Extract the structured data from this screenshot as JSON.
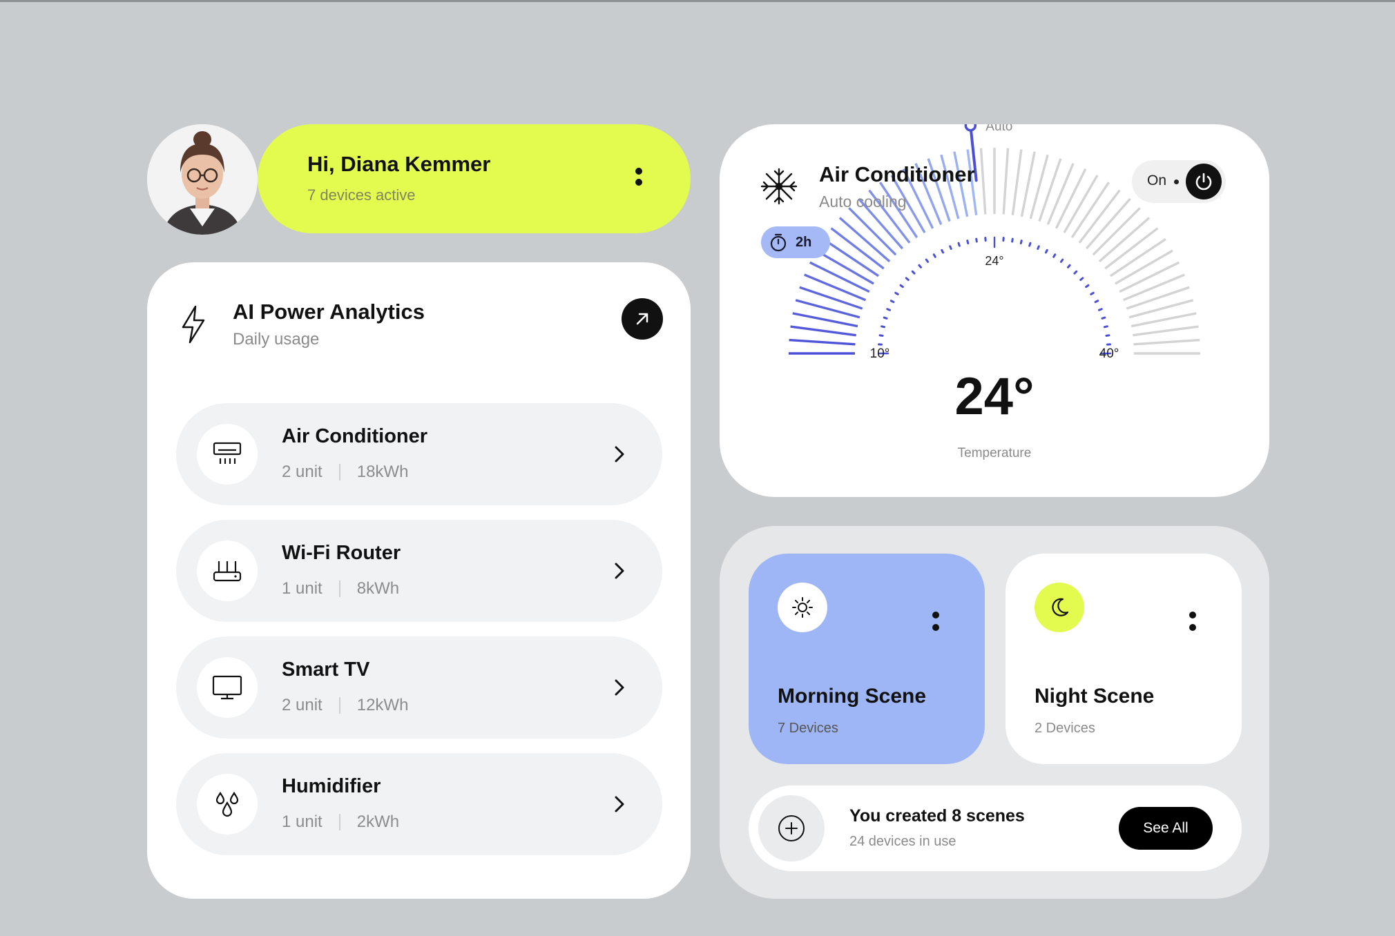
{
  "greeting": {
    "title": "Hi, Diana Kemmer",
    "subtitle": "7 devices active"
  },
  "analytics": {
    "title": "AI Power Analytics",
    "subtitle": "Daily usage",
    "devices": [
      {
        "name": "Air Conditioner",
        "units": "2 unit",
        "energy": "18kWh",
        "icon": "air-conditioner-icon"
      },
      {
        "name": "Wi-Fi Router",
        "units": "1 unit",
        "energy": "8kWh",
        "icon": "router-icon"
      },
      {
        "name": "Smart TV",
        "units": "2 unit",
        "energy": "12kWh",
        "icon": "tv-icon"
      },
      {
        "name": "Humidifier",
        "units": "1 unit",
        "energy": "2kWh",
        "icon": "droplets-icon"
      }
    ]
  },
  "ac": {
    "title": "Air Conditioner",
    "subtitle": "Auto cooling",
    "power_label": "On",
    "timer": "2h",
    "auto_label": "Auto",
    "temperature": "24°",
    "temperature_label": "Temperature",
    "scale_min_label": "10°",
    "scale_mid_label": "24°",
    "scale_max_label": "40°",
    "scale_min": 10,
    "scale_max": 40,
    "setpoint": 24,
    "colors": {
      "accent": "#4a4fd6",
      "inactive": "#d3d3d3"
    }
  },
  "scenes": {
    "items": [
      {
        "name": "Morning Scene",
        "devices": "7 Devices",
        "icon": "sun-icon"
      },
      {
        "name": "Night Scene",
        "devices": "2 Devices",
        "icon": "moon-icon"
      }
    ],
    "summary_title": "You created 8 scenes",
    "summary_sub": "24 devices in use",
    "see_all": "See All"
  },
  "colors": {
    "lime": "#e3fb4e",
    "periwinkle": "#9fb6f6",
    "background": "#c9cccf"
  }
}
